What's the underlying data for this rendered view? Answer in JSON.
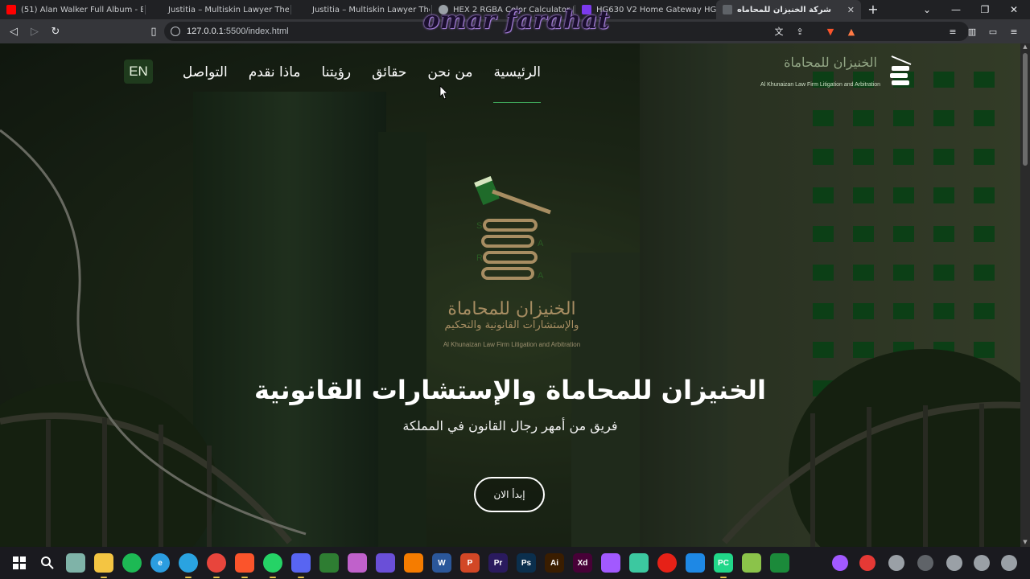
{
  "browser": {
    "tabs": [
      {
        "label": "(51) Alan Walker Full Album - B",
        "favicon_color": "#ff0000",
        "active": false
      },
      {
        "label": "Justitia – Multiskin Lawyer Theme",
        "favicon_color": "#4a4c50",
        "active": false
      },
      {
        "label": "Justitia – Multiskin Lawyer Theme",
        "favicon_color": "#4a4c50",
        "active": false
      },
      {
        "label": "HEX 2 RGBA Color Calculator | b",
        "favicon_color": "#9aa0a6",
        "active": false
      },
      {
        "label": "HG630 V2 Home Gateway HG630",
        "favicon_color": "#7c3aed",
        "active": false
      },
      {
        "label": "شركة الخنيزان للمحاماه",
        "favicon_color": "#5f6368",
        "active": true
      }
    ],
    "new_tab_label": "+",
    "url_host": "127.0.0.1",
    "url_rest": ":5500/index.html",
    "watermark": "omar farahat"
  },
  "page": {
    "nav": [
      {
        "label": "الرئيسية",
        "active": true
      },
      {
        "label": "من نحن",
        "active": false
      },
      {
        "label": "حقائق",
        "active": false
      },
      {
        "label": "رؤيتنا",
        "active": false
      },
      {
        "label": "ماذا نقدم",
        "active": false
      },
      {
        "label": "التواصل",
        "active": false
      }
    ],
    "lang_button": "EN",
    "corner_logo": {
      "arabic": "الخنيزان للمحاماة",
      "english": "Al Khunaizan Law Firm Litigation and Arbitration"
    },
    "center_logo": {
      "line1": "الخنيزان للمحاماة",
      "line2": "والإستشارات القانونية والتحكيم",
      "english": "Al Khunaizan Law Firm Litigation and Arbitration",
      "letters": [
        "S",
        "A",
        "R",
        "A"
      ]
    },
    "hero": {
      "title": "الخنيزان للمحاماة والإستشارات القانونية",
      "subtitle": "فريق من أمهر رجال القانون في المملكة",
      "cta": "إبدأ الان"
    },
    "colors": {
      "accent_green": "#3fa75a",
      "logo_gold": "#a78d62",
      "window_green": "#0f5a1e"
    }
  },
  "taskbar": {
    "apps": [
      {
        "name": "windows-start-icon",
        "color": "#ffffff",
        "glyph": ""
      },
      {
        "name": "search-icon",
        "color": "#8ab4f8",
        "glyph": ""
      },
      {
        "name": "monitor-app-icon",
        "color": "#7fb3a8",
        "glyph": ""
      },
      {
        "name": "file-explorer-icon",
        "color": "#f4c542",
        "glyph": ""
      },
      {
        "name": "spotify-icon",
        "color": "#1db954",
        "glyph": ""
      },
      {
        "name": "edge-icon",
        "color": "#2b9de0",
        "glyph": "e"
      },
      {
        "name": "telegram-icon",
        "color": "#2aa3e0",
        "glyph": ""
      },
      {
        "name": "chrome-icon",
        "color": "#e8453c",
        "glyph": ""
      },
      {
        "name": "brave-icon",
        "color": "#fb542b",
        "glyph": ""
      },
      {
        "name": "whatsapp-icon",
        "color": "#25d366",
        "glyph": ""
      },
      {
        "name": "discord-icon",
        "color": "#5865f2",
        "glyph": ""
      },
      {
        "name": "chart-app-icon",
        "color": "#2e7d32",
        "glyph": ""
      },
      {
        "name": "music-icon",
        "color": "#c061cb",
        "glyph": ""
      },
      {
        "name": "media-app-icon",
        "color": "#6a4fd8",
        "glyph": ""
      },
      {
        "name": "fruit-app-icon",
        "color": "#f57c00",
        "glyph": ""
      },
      {
        "name": "word-icon",
        "color": "#2b579a",
        "glyph": "W"
      },
      {
        "name": "powerpoint-icon",
        "color": "#d24726",
        "glyph": "P"
      },
      {
        "name": "premiere-icon",
        "color": "#2a1a5e",
        "glyph": "Pr"
      },
      {
        "name": "photoshop-icon",
        "color": "#0b2f4d",
        "glyph": "Ps"
      },
      {
        "name": "illustrator-icon",
        "color": "#3a1d00",
        "glyph": "Ai"
      },
      {
        "name": "xd-icon",
        "color": "#470137",
        "glyph": "Xd"
      },
      {
        "name": "figma-icon",
        "color": "#a259ff",
        "glyph": ""
      },
      {
        "name": "vpn-icon",
        "color": "#3cc8a0",
        "glyph": ""
      },
      {
        "name": "youtube-icon",
        "color": "#e62117",
        "glyph": ""
      },
      {
        "name": "vscode-icon",
        "color": "#1e88e5",
        "glyph": ""
      },
      {
        "name": "pycharm-icon",
        "color": "#21d789",
        "glyph": "PC"
      },
      {
        "name": "blocks-app-icon",
        "color": "#8bc34a",
        "glyph": ""
      },
      {
        "name": "green-app-icon",
        "color": "#1b8a3a",
        "glyph": ""
      }
    ]
  }
}
